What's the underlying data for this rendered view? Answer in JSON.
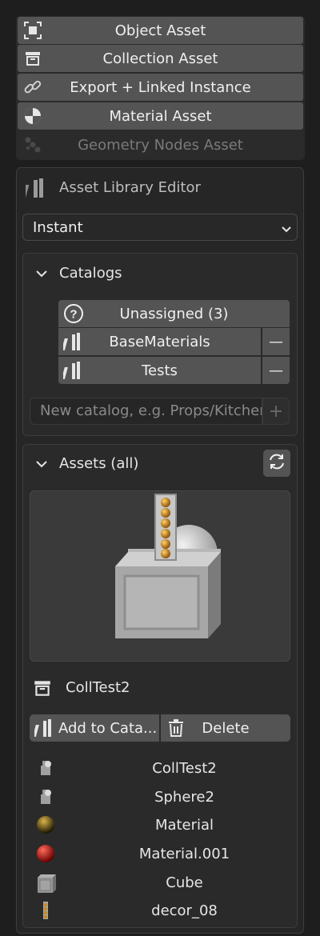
{
  "mark_buttons": [
    {
      "label": "Object Asset",
      "icon": "object-bounds-icon"
    },
    {
      "label": "Collection Asset",
      "icon": "collection-box-icon"
    },
    {
      "label": "Export + Linked Instance",
      "icon": "link-icon"
    },
    {
      "label": "Material Asset",
      "icon": "material-sphere-icon"
    },
    {
      "label": "Geometry Nodes Asset",
      "icon": "geometry-nodes-icon"
    }
  ],
  "editor": {
    "title": "Asset Library Editor",
    "library_select": "Instant"
  },
  "catalogs": {
    "header": "Catalogs",
    "items": [
      {
        "label": "Unassigned (3)",
        "removable": false
      },
      {
        "label": "BaseMaterials",
        "removable": true
      },
      {
        "label": "Tests",
        "removable": true
      }
    ],
    "remove_symbol": "—",
    "new_placeholder": "New catalog, e.g. Props/Kitchen",
    "add_symbol": "+"
  },
  "assets": {
    "header": "Assets (all)",
    "selected_name": "CollTest2",
    "add_to_catalog_label": "Add to Cata...",
    "delete_label": "Delete",
    "list": [
      {
        "name": "CollTest2",
        "thumb": "collection-thumb-icon"
      },
      {
        "name": "Sphere2",
        "thumb": "object-thumb-icon"
      },
      {
        "name": "Material",
        "thumb": "gold-material-thumb-icon"
      },
      {
        "name": "Material.001",
        "thumb": "red-material-thumb-icon"
      },
      {
        "name": "Cube",
        "thumb": "cube-thumb-icon"
      },
      {
        "name": "decor_08",
        "thumb": "decor-thumb-icon"
      }
    ]
  },
  "colors": {
    "button": "#545454",
    "panel": "#262626",
    "background": "#1e1e1e"
  }
}
